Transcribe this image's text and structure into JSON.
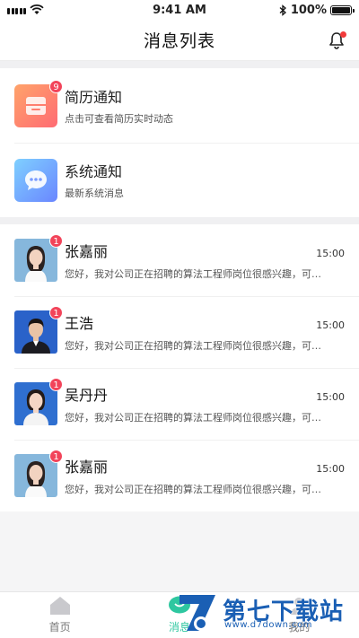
{
  "status_bar": {
    "time": "9:41 AM",
    "battery": "100%"
  },
  "header": {
    "title": "消息列表"
  },
  "notices": [
    {
      "title": "简历通知",
      "subtitle": "点击可查看简历实时动态",
      "badge": "9",
      "icon": "resume-icon",
      "color": "#ff8a6e"
    },
    {
      "title": "系统通知",
      "subtitle": "最新系统消息",
      "icon": "chat-bubble-icon",
      "color": "#7aa6ff"
    }
  ],
  "messages": [
    {
      "name": "张嘉丽",
      "time": "15:00",
      "preview": "您好，我对公司正在招聘的算法工程师岗位很感兴趣，可…",
      "badge": "1",
      "avatar_bg": "#7fb2d8",
      "gender": "female"
    },
    {
      "name": "王浩",
      "time": "15:00",
      "preview": "您好，我对公司正在招聘的算法工程师岗位很感兴趣，可…",
      "badge": "1",
      "avatar_bg": "#2a62c9",
      "gender": "male"
    },
    {
      "name": "吴丹丹",
      "time": "15:00",
      "preview": "您好，我对公司正在招聘的算法工程师岗位很感兴趣，可…",
      "badge": "1",
      "avatar_bg": "#2f6fd0",
      "gender": "female"
    },
    {
      "name": "张嘉丽",
      "time": "15:00",
      "preview": "您好，我对公司正在招聘的算法工程师岗位很感兴趣，可…",
      "badge": "1",
      "avatar_bg": "#7fb2d8",
      "gender": "female"
    }
  ],
  "tabbar": {
    "home": "首页",
    "messages": "消息",
    "mine": "我的"
  },
  "watermark": {
    "text": "第七下载站",
    "url": "www.d7down.com"
  },
  "colors": {
    "accent": "#2ec7a0",
    "badge": "#f2445a"
  }
}
